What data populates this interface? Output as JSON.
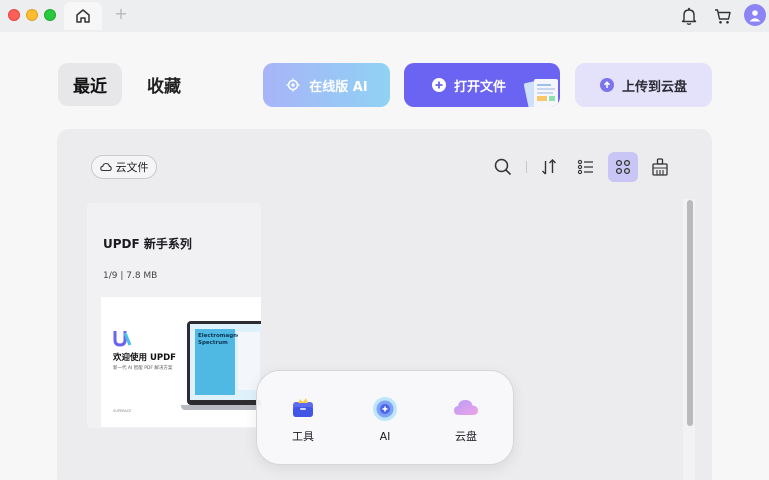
{
  "titlebar": {
    "new_tab_symbol": "+"
  },
  "nav": {
    "recent_label": "最近",
    "favorites_label": "收藏"
  },
  "actions": {
    "ai_online_label": "在线版 AI",
    "open_file_label": "打开文件",
    "upload_cloud_label": "上传到云盘"
  },
  "toolbar": {
    "cloud_files_label": "云文件",
    "icons": [
      "search-icon",
      "sort-icon",
      "list-view-icon",
      "grid-view-icon",
      "clean-icon"
    ]
  },
  "files": [
    {
      "title": "UPDF 新手系列",
      "meta": "1/9  |  7.8 MB",
      "thumb_heading": "欢迎使用 UPDF",
      "thumb_sub": "新一代 AI 智能 PDF 解决方案",
      "thumb_footer": "SUPERACE",
      "thumb_screen_title": "Electromagnetic Spectrum"
    }
  ],
  "dock": {
    "items": [
      {
        "label": "工具",
        "icon": "toolbox-icon"
      },
      {
        "label": "AI",
        "icon": "ai-orb-icon"
      },
      {
        "label": "云盘",
        "icon": "cloud-drive-icon"
      }
    ]
  },
  "colors": {
    "accent": "#6b63f1",
    "ai_gradient_start": "#a8b4f8",
    "ai_gradient_end": "#8fd2f4",
    "upload_bg": "#e4e2fb",
    "active_tool": "#c9c6f5"
  }
}
